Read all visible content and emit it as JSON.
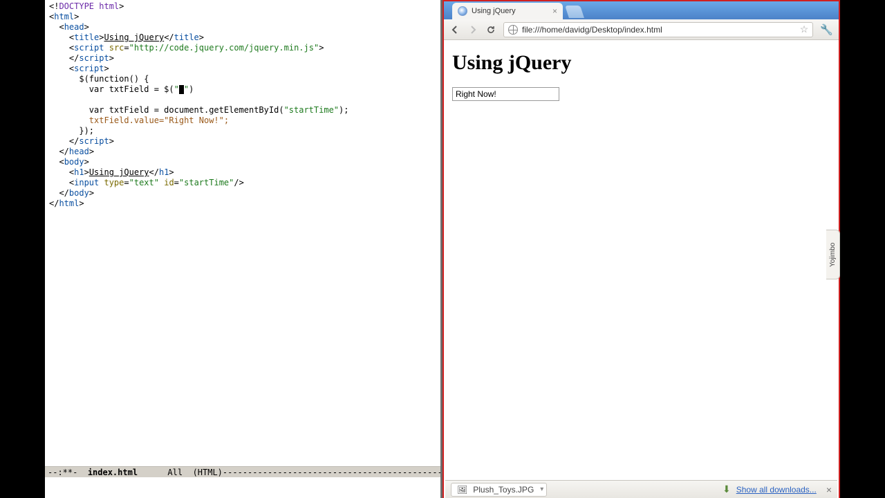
{
  "editor": {
    "filename": "index.html",
    "position": "All",
    "mode": "(HTML)",
    "modified": "--:**-",
    "code": {
      "doctype": "DOCTYPE html",
      "title_text": "Using jQuery",
      "script_src": "http://code.jquery.com/jquery.min.js",
      "jq_open": "$(function() {",
      "jq_line_a_prefix": "var txtField = $(",
      "jq_line_a_q1": "\"",
      "jq_line_a_q2": "\"",
      "jq_line_a_suffix": ")",
      "jq_blank": "",
      "jq_line_b_prefix": "var txtField = document.getElementById(",
      "jq_line_b_arg": "\"startTime\"",
      "jq_line_b_suffix": ");",
      "jq_line_c": "txtField.value=\"Right Now!\";",
      "jq_close": "});",
      "h1_text": "Using jQuery",
      "input_type": "\"text\"",
      "input_id": "\"startTime\""
    }
  },
  "browser": {
    "tab_title": "Using jQuery",
    "url": "file:///home/davidg/Desktop/index.html",
    "page_heading": "Using jQuery",
    "input_value": "Right Now!",
    "sidetab": "Yojimbo",
    "download_item": "Plush_Toys.JPG",
    "show_all": "Show all downloads..."
  }
}
